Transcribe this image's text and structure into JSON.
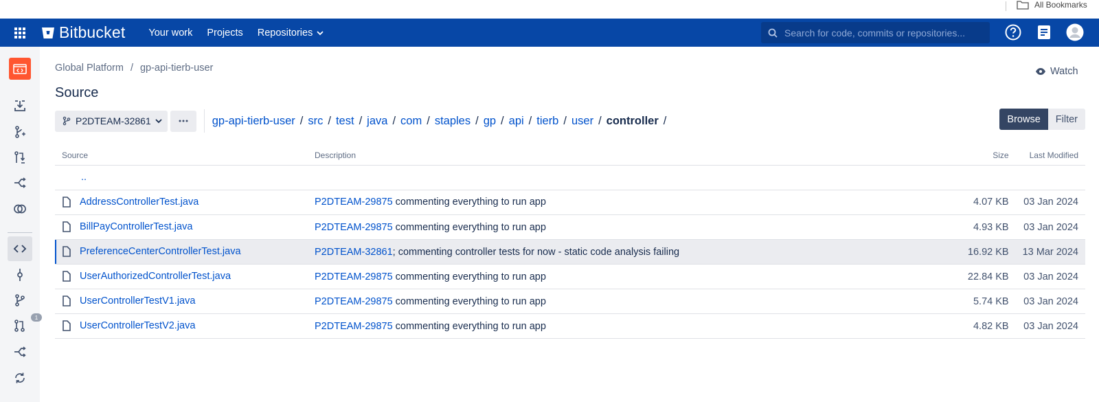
{
  "bookmarks": {
    "label": "All Bookmarks"
  },
  "header": {
    "brand": "Bitbucket",
    "nav": [
      "Your work",
      "Projects",
      "Repositories"
    ],
    "search_placeholder": "Search for code, commits or repositories..."
  },
  "breadcrumb": {
    "project": "Global Platform",
    "separator": "/",
    "repo": "gp-api-tierb-user"
  },
  "watch_label": "Watch",
  "page_title": "Source",
  "branch": "P2DTEAM-32861",
  "path": {
    "segments": [
      "gp-api-tierb-user",
      "src",
      "test",
      "java",
      "com",
      "staples",
      "gp",
      "api",
      "tierb",
      "user"
    ],
    "current": "controller",
    "separator": "/"
  },
  "view_toggle": {
    "browse": "Browse",
    "filter": "Filter"
  },
  "table": {
    "headers": {
      "source": "Source",
      "description": "Description",
      "size": "Size",
      "modified": "Last Modified"
    },
    "parent": "..",
    "rows": [
      {
        "name": "AddressControllerTest.java",
        "commit": "P2DTEAM-29875",
        "message": " commenting everything to run app",
        "size": "4.07 KB",
        "date": "03 Jan 2024"
      },
      {
        "name": "BillPayControllerTest.java",
        "commit": "P2DTEAM-29875",
        "message": " commenting everything to run app",
        "size": "4.93 KB",
        "date": "03 Jan 2024"
      },
      {
        "name": "PreferenceCenterControllerTest.java",
        "commit": "P2DTEAM-32861",
        "message": "; commenting controller tests for now - static code analysis failing",
        "size": "16.92 KB",
        "date": "13 Mar 2024"
      },
      {
        "name": "UserAuthorizedControllerTest.java",
        "commit": "P2DTEAM-29875",
        "message": " commenting everything to run app",
        "size": "22.84 KB",
        "date": "03 Jan 2024"
      },
      {
        "name": "UserControllerTestV1.java",
        "commit": "P2DTEAM-29875",
        "message": " commenting everything to run app",
        "size": "5.74 KB",
        "date": "03 Jan 2024"
      },
      {
        "name": "UserControllerTestV2.java",
        "commit": "P2DTEAM-29875",
        "message": " commenting everything to run app",
        "size": "4.82 KB",
        "date": "03 Jan 2024"
      }
    ]
  },
  "sidebar": {
    "pr_badge": "1"
  },
  "colors": {
    "header": "#0747a6",
    "link": "#0052cc",
    "repo_avatar": "#ff5630"
  }
}
